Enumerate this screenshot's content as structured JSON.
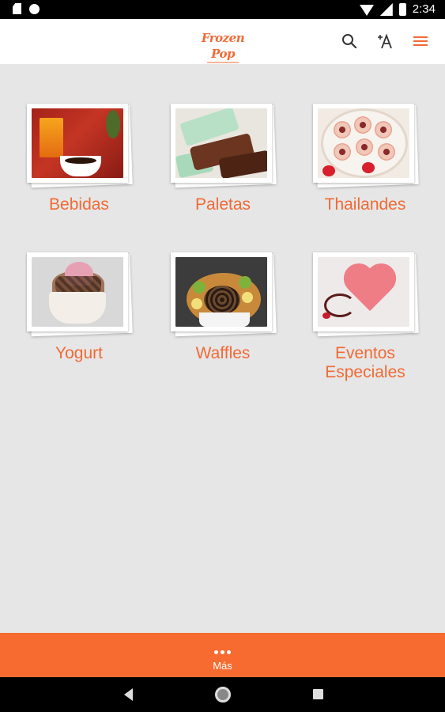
{
  "status_bar": {
    "time": "2:34",
    "icons": [
      "sd-card-icon",
      "circle-notification-icon",
      "wifi-icon",
      "signal-icon",
      "battery-icon"
    ]
  },
  "app_bar": {
    "logo_text": "Frozen Pop",
    "icons": [
      "search-icon",
      "font-size-icon",
      "hamburger-menu-icon"
    ],
    "accent_color": "#f06a35"
  },
  "categories": [
    {
      "label": "Bebidas"
    },
    {
      "label": "Paletas"
    },
    {
      "label": "Thailandes"
    },
    {
      "label": "Yogurt"
    },
    {
      "label": "Waffles"
    },
    {
      "label": "Eventos Especiales"
    }
  ],
  "bottom_bar": {
    "label": "Más",
    "icon": "more-dots-icon",
    "color": "#f76b30"
  },
  "nav_bar": {
    "icons": [
      "back-icon",
      "home-icon",
      "recents-icon"
    ]
  }
}
